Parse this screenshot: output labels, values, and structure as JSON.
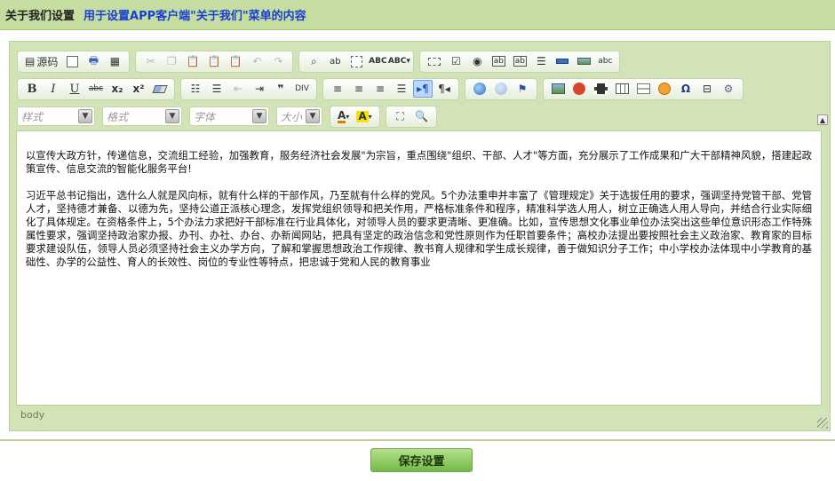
{
  "header": {
    "title": "关于我们设置",
    "subtitle": "用于设置APP客户端\"关于我们\"菜单的内容"
  },
  "toolbar": {
    "source_label": "源码",
    "row1": [
      "source",
      "new-page",
      "preview",
      "templates",
      "cut",
      "copy",
      "paste",
      "paste-text",
      "paste-word",
      "undo",
      "redo",
      "find",
      "replace",
      "select-all",
      "spell-check",
      "spell-check-menu",
      "form",
      "checkbox",
      "radio",
      "text-field",
      "textarea",
      "select",
      "button",
      "image-button",
      "hidden-field"
    ],
    "row2": [
      "bold",
      "italic",
      "underline",
      "strike",
      "subscript",
      "superscript",
      "remove-format",
      "numbered-list",
      "bulleted-list",
      "outdent",
      "indent",
      "blockquote",
      "div",
      "align-left",
      "align-center",
      "align-right",
      "justify",
      "ltr",
      "rtl",
      "link",
      "unlink",
      "anchor",
      "image",
      "flash",
      "video",
      "table",
      "horizontal-rule",
      "smiley",
      "special-char",
      "page-break",
      "iframe"
    ],
    "combos": {
      "style": "样式",
      "format": "格式",
      "font": "字体",
      "size": "大小"
    }
  },
  "editor": {
    "content": [
      "以宣传大政方针，传递信息，交流组工经验，加强教育，服务经济社会发展\"为宗旨，重点围绕\"组织、干部、人才\"等方面，充分展示了工作成果和广大干部精神风貌，搭建起政策宣传、信息交流的智能化服务平台!",
      "习近平总书记指出，选什么人就是风向标，就有什么样的干部作风，乃至就有什么样的党风。5个办法重申并丰富了《管理规定》关于选拔任用的要求，强调坚持党管干部、党管人才，坚持德才兼备、以德为先，坚持公道正派核心理念，发挥党组织领导和把关作用，严格标准条件和程序，精准科学选人用人，树立正确选人用人导向，并结合行业实际细化了具体规定。在资格条件上，5个办法力求把好干部标准在行业具体化，对领导人员的要求更清晰、更准确。比如，宣传思想文化事业单位办法突出这些单位意识形态工作特殊属性要求，强调坚持政治家办报、办刊、办社、办台、办新闻网站，把具有坚定的政治信念和党性原则作为任职首要条件；高校办法提出要按照社会主义政治家、教育家的目标要求建设队伍，领导人员必须坚持社会主义办学方向，了解和掌握思想政治工作规律、教书育人规律和学生成长规律，善于做知识分子工作；中小学校办法体现中小学教育的基础性、办学的公益性、育人的长效性、岗位的专业性等特点，把忠诚于党和人民的教育事业"
    ],
    "status_path": "body"
  },
  "actions": {
    "save_label": "保存设置"
  }
}
